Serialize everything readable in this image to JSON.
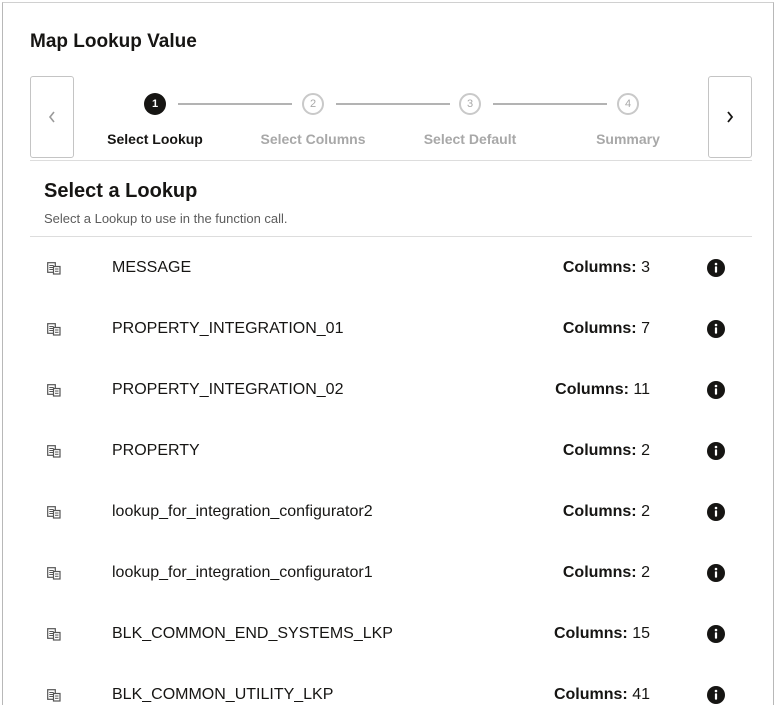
{
  "dialog": {
    "title": "Map Lookup Value"
  },
  "train": {
    "steps": [
      {
        "number": "1",
        "label": "Select Lookup",
        "state": "active"
      },
      {
        "number": "2",
        "label": "Select Columns",
        "state": "inactive"
      },
      {
        "number": "3",
        "label": "Select Default",
        "state": "inactive"
      },
      {
        "number": "4",
        "label": "Summary",
        "state": "inactive"
      }
    ],
    "prev_icon": "chevron-left-icon",
    "next_icon": "chevron-right-icon"
  },
  "section": {
    "title": "Select a Lookup",
    "subtitle": "Select a Lookup to use in the function call."
  },
  "columns_label": "Columns:",
  "lookups": [
    {
      "name": "MESSAGE",
      "columns": "3"
    },
    {
      "name": "PROPERTY_INTEGRATION_01",
      "columns": "7"
    },
    {
      "name": "PROPERTY_INTEGRATION_02",
      "columns": "11"
    },
    {
      "name": "PROPERTY",
      "columns": "2"
    },
    {
      "name": "lookup_for_integration_configurator2",
      "columns": "2"
    },
    {
      "name": "lookup_for_integration_configurator1",
      "columns": "2"
    },
    {
      "name": "BLK_COMMON_END_SYSTEMS_LKP",
      "columns": "15"
    },
    {
      "name": "BLK_COMMON_UTILITY_LKP",
      "columns": "41"
    }
  ],
  "icons": {
    "lookup": "lookup-table-icon",
    "info": "info-icon"
  },
  "colors": {
    "active_step": "#161513",
    "inactive_step": "#a8a8a8",
    "text": "#161513",
    "muted": "#5c5c5c"
  }
}
